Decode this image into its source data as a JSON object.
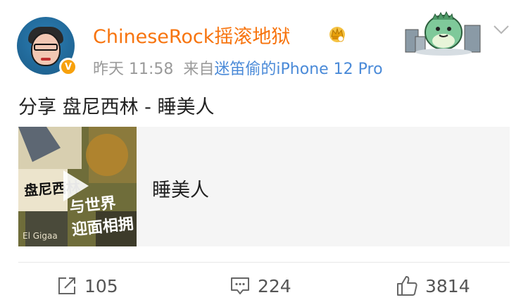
{
  "post": {
    "username": "ChineseRock摇滚地狱",
    "time": "昨天 11:58",
    "source_prefix": "来自",
    "source": "迷笛偷的iPhone 12 Pro",
    "text": "分享 盘尼西林 - 睡美人"
  },
  "card": {
    "title": "睡美人",
    "cover_art_text": "与世界 迎面相拥",
    "cover_signature": "盘尼西林",
    "cover_bottom_text": "El Gigaa"
  },
  "actions": {
    "repost_count": "105",
    "comment_count": "224",
    "like_count": "3814"
  },
  "icons": {
    "avatar": "avatar-image",
    "verified": "v-badge-icon",
    "crown": "crown-icon",
    "sticker": "dinosaur-sticker",
    "more": "chevron-down-icon",
    "repost": "share-icon",
    "comment": "comment-icon",
    "like": "thumbs-up-icon"
  },
  "colors": {
    "username": "#f7740e",
    "source_link": "#4a8ad8",
    "meta": "#9a9a9a",
    "verified": "#f7a10d",
    "card_bg": "#f5f5f5"
  }
}
